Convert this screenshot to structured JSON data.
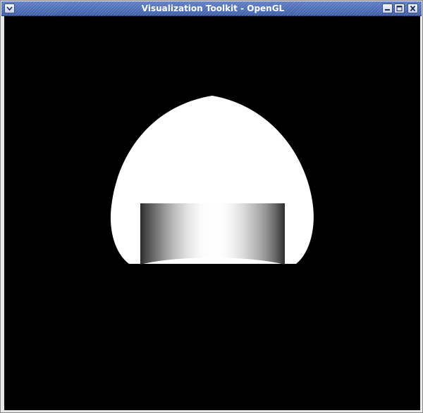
{
  "window": {
    "title": "Visualization Toolkit - OpenGL",
    "titlebar_color": "#4f6fb8",
    "title_text_color": "#ffffff",
    "buttons": [
      {
        "name": "window-menu",
        "icon": "chevron-down-icon"
      },
      {
        "name": "minimize",
        "icon": "minimize-icon"
      },
      {
        "name": "maximize",
        "icon": "maximize-icon"
      },
      {
        "name": "close",
        "icon": "close-icon"
      }
    ]
  },
  "viewport": {
    "background_color": "#000000",
    "scene": "white-dome-with-gray-shaded-cylinder",
    "object_color": "#ffffff"
  }
}
